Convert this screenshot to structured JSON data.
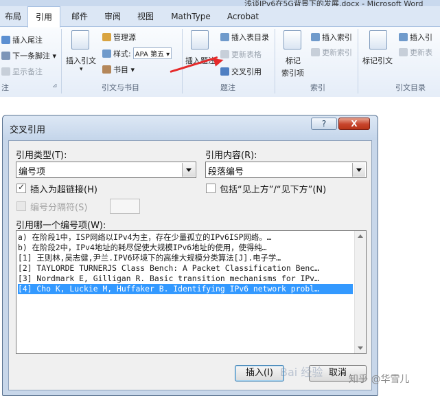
{
  "window": {
    "doc_title": "浅谈IPv6在5G背景下的发展.docx - Microsoft Word"
  },
  "ribbon": {
    "tabs": [
      "布局",
      "引用",
      "邮件",
      "审阅",
      "视图",
      "MathType",
      "Acrobat"
    ],
    "footnotes": {
      "insert_endnote": "插入尾注",
      "next_footnote": "下一条脚注",
      "show_notes": "显示备注",
      "group_label": "注"
    },
    "citations": {
      "insert_citation": "插入引文",
      "manage_sources": "管理源",
      "style_label": "样式:",
      "style_value": "APA 第五",
      "bibliography": "书目",
      "group_label": "引文与书目"
    },
    "captions": {
      "insert_caption": "插入题注",
      "insert_table_of_figures": "插入表目录",
      "update_table": "更新表格",
      "cross_reference": "交叉引用",
      "group_label": "题注"
    },
    "index": {
      "mark_entry_line1": "标记",
      "mark_entry_line2": "索引项",
      "insert_index": "插入索引",
      "update_index": "更新索引",
      "group_label": "索引"
    },
    "toa": {
      "mark_citation": "标记引文",
      "insert_toa": "插入引",
      "update_toa": "更新表",
      "group_label": "引文目录"
    }
  },
  "dialog": {
    "title": "交叉引用",
    "help_glyph": "?",
    "close_glyph": "X",
    "reference_type_label": "引用类型(T):",
    "reference_type_value": "编号项",
    "insert_reference_to_label": "引用内容(R):",
    "insert_reference_to_value": "段落编号",
    "insert_as_hyperlink_label": "插入为超链接(H)",
    "include_above_below_label": "包括“见上方”/“见下方”(N)",
    "separate_numbers_label": "编号分隔符(S)",
    "for_which_label": "引用哪一个编号项(W):",
    "items": [
      "  a) 在阶段1中，ISP网络以IPv4为主，存在少量孤立的IPv6ISP网络。…",
      "  b) 在阶段2中，IPv4地址的耗尽促使大规模IPv6地址的使用，使得纯…",
      "[1] 王则林,吴志健,尹兰.IPV6环境下的高维大规模分类算法[J].电子学…",
      "[2] TAYLORDE TURNERJS Class Bench: A Packet Classification Benc…",
      "[3] Nordmark E, Gilligan R. Basic transition mechanisms for IPv…",
      "[4] Cho K, Luckie M, Huffaker B. Identifying IPv6 network probl…"
    ],
    "insert_button": "插入(I)",
    "cancel_button": "取消"
  },
  "watermark": {
    "baidu": "Bai 经验",
    "zhihu": "知乎 @华雪儿"
  },
  "colors": {
    "selection": "#3399ff",
    "arrow": "#e52a2a",
    "close": "#c7432b"
  }
}
